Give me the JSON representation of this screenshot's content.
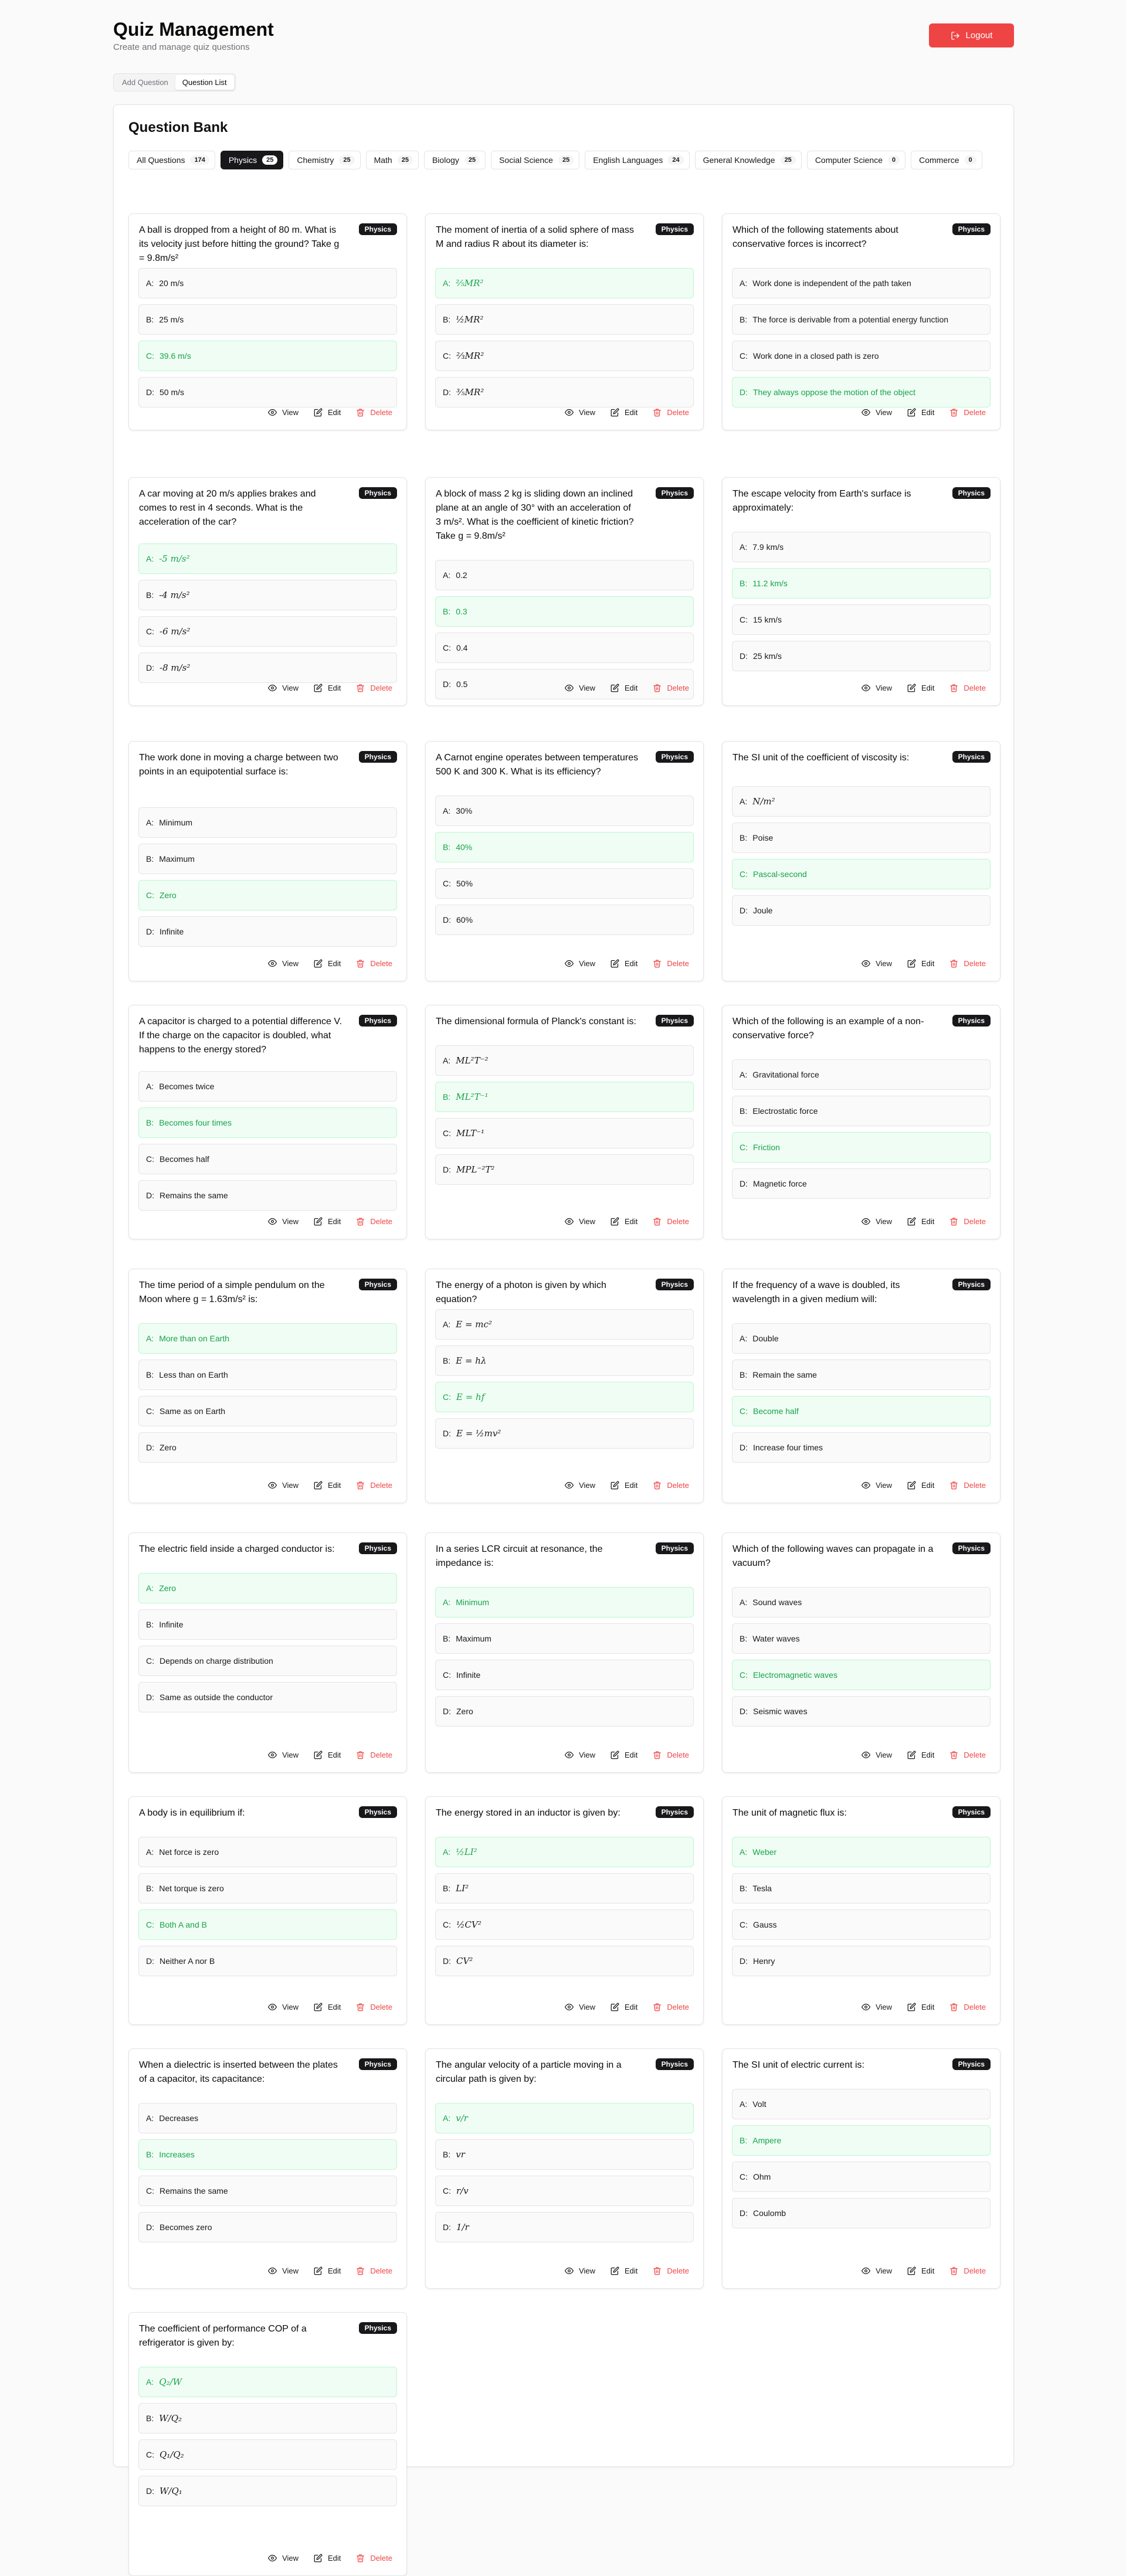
{
  "header": {
    "title": "Quiz Management",
    "subtitle": "Create and manage quiz questions",
    "logout_label": "Logout"
  },
  "tabs": [
    {
      "label": "Add Question",
      "active": false
    },
    {
      "label": "Question List",
      "active": true
    }
  ],
  "bank": {
    "title": "Question Bank",
    "filters": [
      {
        "label": "All Questions",
        "count": "174",
        "active": false
      },
      {
        "label": "Physics",
        "count": "25",
        "active": true
      },
      {
        "label": "Chemistry",
        "count": "25",
        "active": false
      },
      {
        "label": "Math",
        "count": "25",
        "active": false
      },
      {
        "label": "Biology",
        "count": "25",
        "active": false
      },
      {
        "label": "Social Science",
        "count": "25",
        "active": false
      },
      {
        "label": "English Languages",
        "count": "24",
        "active": false
      },
      {
        "label": "General Knowledge",
        "count": "25",
        "active": false
      },
      {
        "label": "Computer Science",
        "count": "0",
        "active": false
      },
      {
        "label": "Commerce",
        "count": "0",
        "active": false
      }
    ]
  },
  "actions": {
    "view": "View",
    "edit": "Edit",
    "delete": "Delete"
  },
  "colors": {
    "accent": "#ef4444",
    "correct": "#16a34a",
    "badge": "#18181b"
  },
  "questions": [
    {
      "subject": "Physics",
      "question": "A ball is dropped from a height of 80 m. What is its velocity just before hitting the ground? Take g = 9.8m/s²",
      "options": [
        "20 m/s",
        "25 m/s",
        "39.6 m/s",
        "50 m/s"
      ],
      "correct": 2
    },
    {
      "subject": "Physics",
      "question": "The moment of inertia of a solid sphere of mass M and radius R about its diameter is:",
      "options": [
        "⅖MR²",
        "½MR²",
        "⅔MR²",
        "⅗MR²"
      ],
      "correct": 0
    },
    {
      "subject": "Physics",
      "question": "Which of the following statements about conservative forces is incorrect?",
      "options": [
        "Work done is independent of the path taken",
        "The force is derivable from a potential energy function",
        "Work done in a closed path is zero",
        "They always oppose the motion of the object"
      ],
      "correct": 3
    },
    {
      "subject": "Physics",
      "question": "A car moving at 20 m/s applies brakes and comes to rest in 4 seconds. What is the acceleration of the car?",
      "options": [
        "-5 m/s²",
        "-4 m/s²",
        "-6 m/s²",
        "-8 m/s²"
      ],
      "correct": 0
    },
    {
      "subject": "Physics",
      "question": "A block of mass 2 kg is sliding down an inclined plane at an angle of 30° with an acceleration of 3 m/s². What is the coefficient of kinetic friction? Take g = 9.8m/s²",
      "options": [
        "0.2",
        "0.3",
        "0.4",
        "0.5"
      ],
      "correct": 1
    },
    {
      "subject": "Physics",
      "question": "The escape velocity from Earth's surface is approximately:",
      "options": [
        "7.9 km/s",
        "11.2 km/s",
        "15 km/s",
        "25 km/s"
      ],
      "correct": 1
    },
    {
      "subject": "Physics",
      "question": "The work done in moving a charge between two points in an equipotential surface is:",
      "options": [
        "Minimum",
        "Maximum",
        "Zero",
        "Infinite"
      ],
      "correct": 2
    },
    {
      "subject": "Physics",
      "question": "A Carnot engine operates between temperatures 500 K and 300 K. What is its efficiency?",
      "options": [
        "30%",
        "40%",
        "50%",
        "60%"
      ],
      "correct": 1
    },
    {
      "subject": "Physics",
      "question": "The SI unit of the coefficient of viscosity is:",
      "options": [
        "N/m²",
        "Poise",
        "Pascal-second",
        "Joule"
      ],
      "correct": 2
    },
    {
      "subject": "Physics",
      "question": "A capacitor is charged to a potential difference V. If the charge on the capacitor is doubled, what happens to the energy stored?",
      "options": [
        "Becomes twice",
        "Becomes four times",
        "Becomes half",
        "Remains the same"
      ],
      "correct": 1
    },
    {
      "subject": "Physics",
      "question": "The dimensional formula of Planck's constant is:",
      "options": [
        "ML²T⁻²",
        "ML²T⁻¹",
        "MLT⁻¹",
        "MPL⁻²T²"
      ],
      "correct": 1
    },
    {
      "subject": "Physics",
      "question": "Which of the following is an example of a non-conservative force?",
      "options": [
        "Gravitational force",
        "Electrostatic force",
        "Friction",
        "Magnetic force"
      ],
      "correct": 2
    },
    {
      "subject": "Physics",
      "question": "The time period of a simple pendulum on the Moon where g = 1.63m/s² is:",
      "options": [
        "More than on Earth",
        "Less than on Earth",
        "Same as on Earth",
        "Zero"
      ],
      "correct": 0
    },
    {
      "subject": "Physics",
      "question": "The energy of a photon is given by which equation?",
      "options": [
        "E = mc²",
        "E = hλ",
        "E = hf",
        "E = ½mv²"
      ],
      "correct": 2
    },
    {
      "subject": "Physics",
      "question": "If the frequency of a wave is doubled, its wavelength in a given medium will:",
      "options": [
        "Double",
        "Remain the same",
        "Become half",
        "Increase four times"
      ],
      "correct": 2
    },
    {
      "subject": "Physics",
      "question": "The electric field inside a charged conductor is:",
      "options": [
        "Zero",
        "Infinite",
        "Depends on charge distribution",
        "Same as outside the conductor"
      ],
      "correct": 0
    },
    {
      "subject": "Physics",
      "question": "In a series LCR circuit at resonance, the impedance is:",
      "options": [
        "Minimum",
        "Maximum",
        "Infinite",
        "Zero"
      ],
      "correct": 0
    },
    {
      "subject": "Physics",
      "question": "Which of the following waves can propagate in a vacuum?",
      "options": [
        "Sound waves",
        "Water waves",
        "Electromagnetic waves",
        "Seismic waves"
      ],
      "correct": 2
    },
    {
      "subject": "Physics",
      "question": "A body is in equilibrium if:",
      "options": [
        "Net force is zero",
        "Net torque is zero",
        "Both A and B",
        "Neither A nor B"
      ],
      "correct": 2
    },
    {
      "subject": "Physics",
      "question": "The energy stored in an inductor is given by:",
      "options": [
        "½LI²",
        "LI²",
        "½CV²",
        "CV²"
      ],
      "correct": 0
    },
    {
      "subject": "Physics",
      "question": "The unit of magnetic flux is:",
      "options": [
        "Weber",
        "Tesla",
        "Gauss",
        "Henry"
      ],
      "correct": 0
    },
    {
      "subject": "Physics",
      "question": "When a dielectric is inserted between the plates of a capacitor, its capacitance:",
      "options": [
        "Decreases",
        "Increases",
        "Remains the same",
        "Becomes zero"
      ],
      "correct": 1
    },
    {
      "subject": "Physics",
      "question": "The angular velocity of a particle moving in a circular path is given by:",
      "options": [
        "v/r",
        "vr",
        "r/v",
        "1/r"
      ],
      "correct": 0
    },
    {
      "subject": "Physics",
      "question": "The SI unit of electric current is:",
      "options": [
        "Volt",
        "Ampere",
        "Ohm",
        "Coulomb"
      ],
      "correct": 1
    },
    {
      "subject": "Physics",
      "question": "The coefficient of performance COP of a refrigerator is given by:",
      "options": [
        "Q₂/W",
        "W/Q₂",
        "Q₁/Q₂",
        "W/Q₁"
      ],
      "correct": 0
    }
  ]
}
